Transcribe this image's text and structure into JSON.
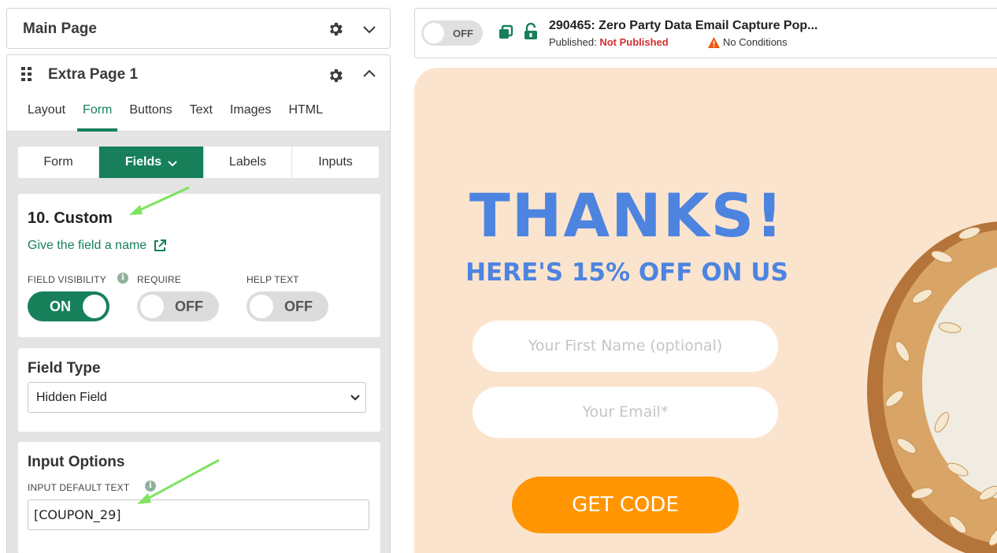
{
  "left_panel": {
    "main_page": {
      "title": "Main Page"
    },
    "extra_page": {
      "title": "Extra Page 1",
      "tabs": [
        {
          "label": "Layout",
          "active": false
        },
        {
          "label": "Form",
          "active": true
        },
        {
          "label": "Buttons",
          "active": false
        },
        {
          "label": "Text",
          "active": false
        },
        {
          "label": "Images",
          "active": false
        },
        {
          "label": "HTML",
          "active": false
        }
      ],
      "subtabs": [
        {
          "label": "Form",
          "active": false
        },
        {
          "label": "Fields",
          "active": true
        },
        {
          "label": "Labels",
          "active": false
        },
        {
          "label": "Inputs",
          "active": false
        }
      ]
    },
    "custom_field": {
      "title": "10. Custom",
      "name_link": "Give the field a name",
      "visibility_label": "FIELD VISIBILITY",
      "require_label": "REQUIRE",
      "help_text_label": "HELP TEXT",
      "info_glyph": "i",
      "visibility_toggle": "ON",
      "require_toggle": "OFF",
      "help_text_toggle": "OFF"
    },
    "field_type": {
      "title": "Field Type",
      "selected": "Hidden Field"
    },
    "input_options": {
      "title": "Input Options",
      "default_text_label": "INPUT DEFAULT TEXT",
      "default_text_value": "[COUPON_29]"
    }
  },
  "topbar": {
    "toggle_label": "OFF",
    "title": "290465: Zero Party Data Email Capture Pop...",
    "published_prefix": "Published:",
    "published_status": "Not Published",
    "conditions": "No Conditions"
  },
  "preview": {
    "headline": "THANKS!",
    "subheadline": "HERE'S 15% OFF ON US",
    "first_name_placeholder": "Your First Name (optional)",
    "email_placeholder": "Your Email*",
    "cta_label": "GET CODE"
  },
  "colors": {
    "brand_green": "#17805a",
    "headline_blue": "#4d84e0",
    "cta_orange": "#ff9500",
    "preview_bg": "#fbe4ce",
    "annotation_arrow": "#7ee35f",
    "error_red": "#d32f2f"
  },
  "icons": [
    "gear-icon",
    "chevron-down-icon",
    "chevron-up-icon",
    "drag-handle-icon",
    "external-link-icon",
    "info-icon",
    "copy-icon",
    "unlock-icon",
    "warning-icon"
  ]
}
